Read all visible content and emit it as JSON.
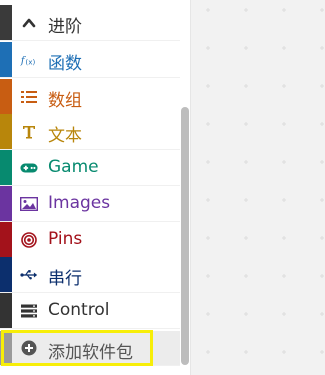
{
  "toolbox": {
    "categories": [
      {
        "label": "进阶",
        "icon": "chevron-up-icon",
        "stripe": "#3a3a3a",
        "text": "#333333",
        "bg": "#ffffff"
      },
      {
        "label": "函数",
        "icon": "function-icon",
        "stripe": "#1e6fb5",
        "text": "#1e6fb5",
        "bg": "#ffffff"
      },
      {
        "label": "数组",
        "icon": "list-icon",
        "stripe": "#c85d12",
        "text": "#c85d12",
        "bg": "#ffffff"
      },
      {
        "label": "文本",
        "icon": "text-icon",
        "stripe": "#b8860b",
        "text": "#b8860b",
        "bg": "#ffffff"
      },
      {
        "label": "Game",
        "icon": "gamepad-icon",
        "stripe": "#078a6f",
        "text": "#078a6f",
        "bg": "#ffffff"
      },
      {
        "label": "Images",
        "icon": "image-icon",
        "stripe": "#6b34a0",
        "text": "#6b34a0",
        "bg": "#ffffff"
      },
      {
        "label": "Pins",
        "icon": "target-icon",
        "stripe": "#a3121b",
        "text": "#a3121b",
        "bg": "#ffffff"
      },
      {
        "label": "串行",
        "icon": "usb-icon",
        "stripe": "#0c2f6d",
        "text": "#0c2f6d",
        "bg": "#ffffff"
      },
      {
        "label": "Control",
        "icon": "control-icon",
        "stripe": "#333333",
        "text": "#333333",
        "bg": "#ffffff"
      },
      {
        "label": "添加软件包",
        "icon": "plus-circle-icon",
        "stripe": "#9a9a9a",
        "text": "#555555",
        "bg": "#ececec"
      }
    ]
  },
  "colors": {
    "workspace": "#f2f2f2",
    "highlight": "#f7ee08"
  }
}
